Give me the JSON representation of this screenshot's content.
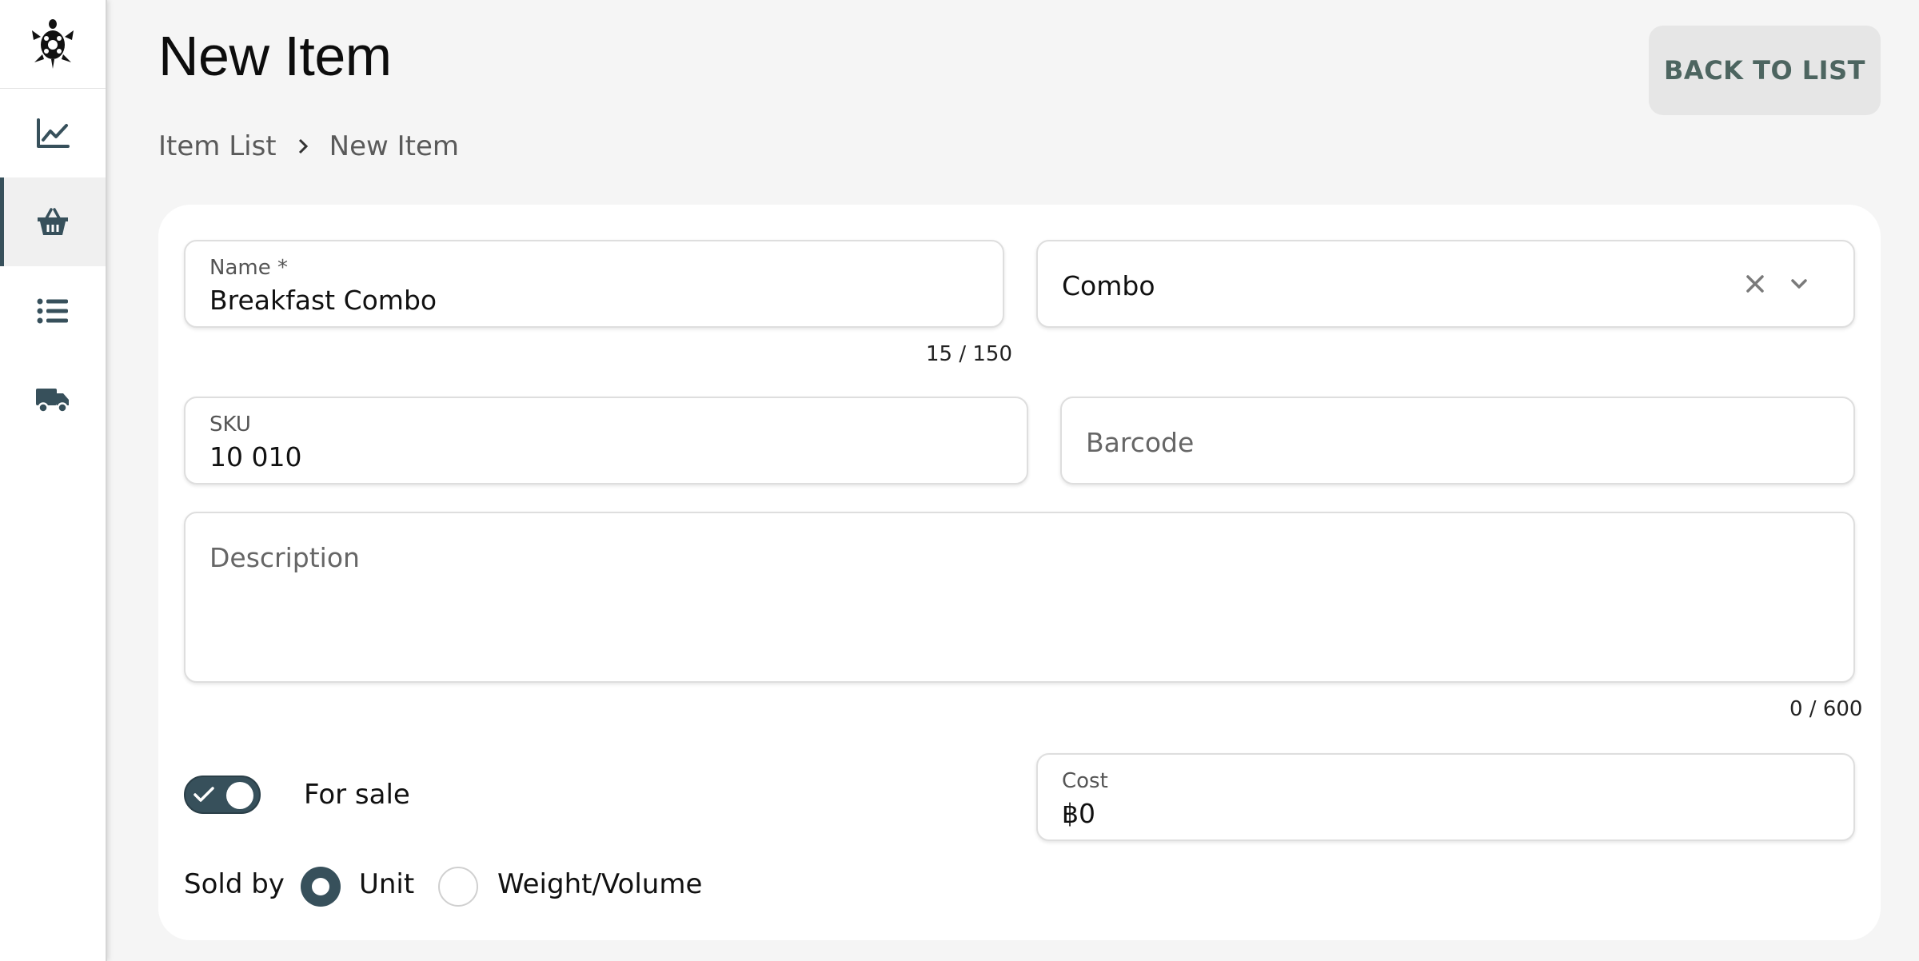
{
  "sidebar": {
    "items": [
      {
        "icon": "chart-line-icon",
        "active": false
      },
      {
        "icon": "basket-icon",
        "active": true
      },
      {
        "icon": "list-icon",
        "active": false
      },
      {
        "icon": "truck-icon",
        "active": false
      }
    ]
  },
  "header": {
    "title": "New Item",
    "back_button": "BACK TO LIST"
  },
  "breadcrumb": {
    "items": [
      "Item List",
      "New Item"
    ]
  },
  "form": {
    "name": {
      "label": "Name *",
      "value": "Breakfast Combo",
      "counter": "15 / 150"
    },
    "category": {
      "value": "Combo"
    },
    "sku": {
      "label": "SKU",
      "value": "10 010"
    },
    "barcode": {
      "placeholder": "Barcode"
    },
    "description": {
      "placeholder": "Description",
      "counter": "0 / 600"
    },
    "for_sale": {
      "label": "For sale",
      "checked": true
    },
    "cost": {
      "label": "Cost",
      "value": "฿0"
    },
    "sold_by": {
      "label": "Sold by",
      "options": [
        {
          "label": "Unit",
          "selected": true
        },
        {
          "label": "Weight/Volume",
          "selected": false
        }
      ]
    }
  },
  "colors": {
    "accent": "#37505b",
    "back_button_text": "#4d6560",
    "background": "#f5f5f5"
  }
}
